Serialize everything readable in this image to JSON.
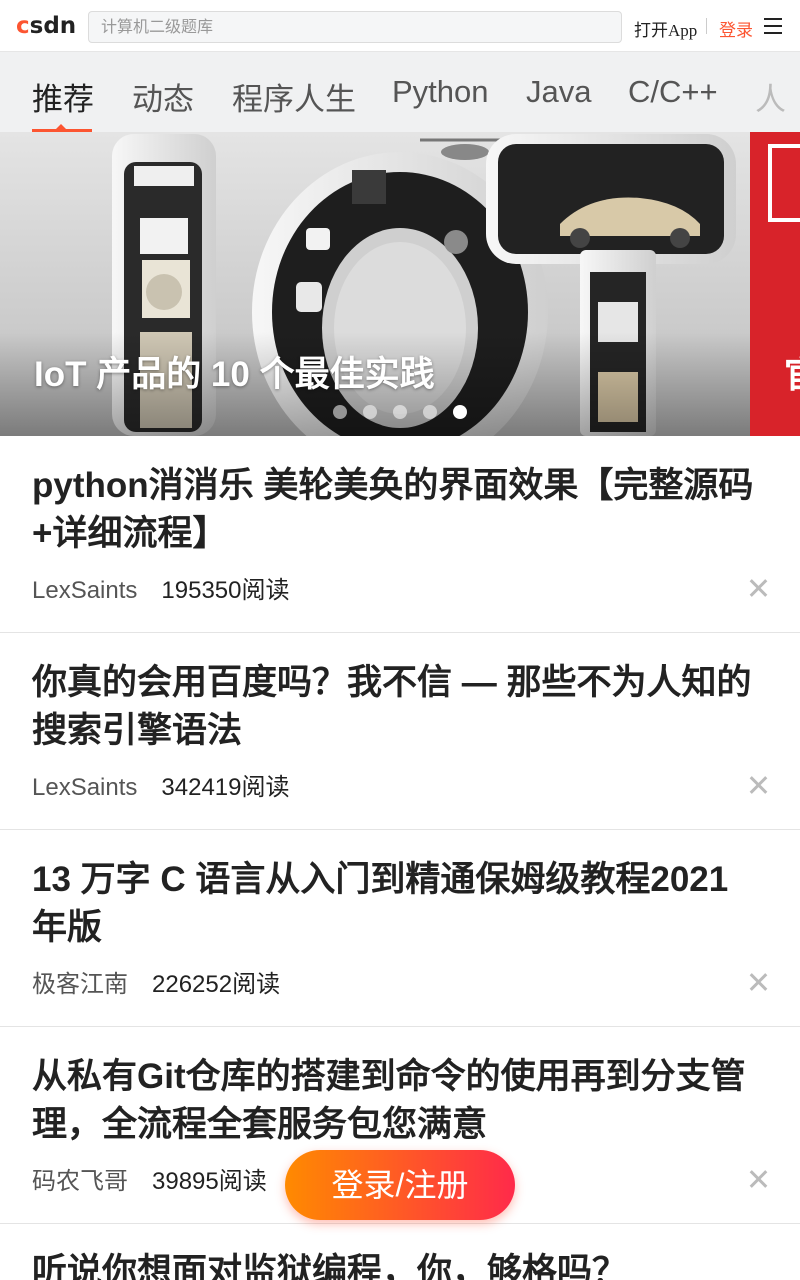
{
  "header": {
    "logo": "csdn",
    "search_placeholder": "计算机二级题库",
    "open_app": "打开App",
    "login": "登录"
  },
  "tabs": [
    {
      "label": "推荐",
      "active": true
    },
    {
      "label": "动态"
    },
    {
      "label": "程序人生"
    },
    {
      "label": "Python"
    },
    {
      "label": "Java"
    },
    {
      "label": "C/C++"
    },
    {
      "label": "人"
    }
  ],
  "banner": {
    "caption": "IoT 产品的 10 个最佳实践",
    "next_slide_text": "官",
    "dots_total": 5,
    "active_dot": 5
  },
  "articles": [
    {
      "title": "python消消乐 美轮美奂的界面效果【完整源码+详细流程】",
      "author": "LexSaints",
      "reads": "195350阅读"
    },
    {
      "title": "你真的会用百度吗？我不信 — 那些不为人知的搜索引擎语法",
      "author": "LexSaints",
      "reads": "342419阅读"
    },
    {
      "title": "13 万字 C 语言从入门到精通保姆级教程2021 年版",
      "author": "极客江南",
      "reads": "226252阅读"
    },
    {
      "title": "从私有Git仓库的搭建到命令的使用再到分支管理，全流程全套服务包您满意",
      "author": "码农飞哥",
      "reads": "39895阅读"
    },
    {
      "title": "听说你想面对监狱编程，你，够格吗？",
      "author": "",
      "reads": ""
    }
  ],
  "floating_button": "登录/注册",
  "colors": {
    "accent": "#fc5531",
    "tab_bg": "#f0f1f2"
  }
}
